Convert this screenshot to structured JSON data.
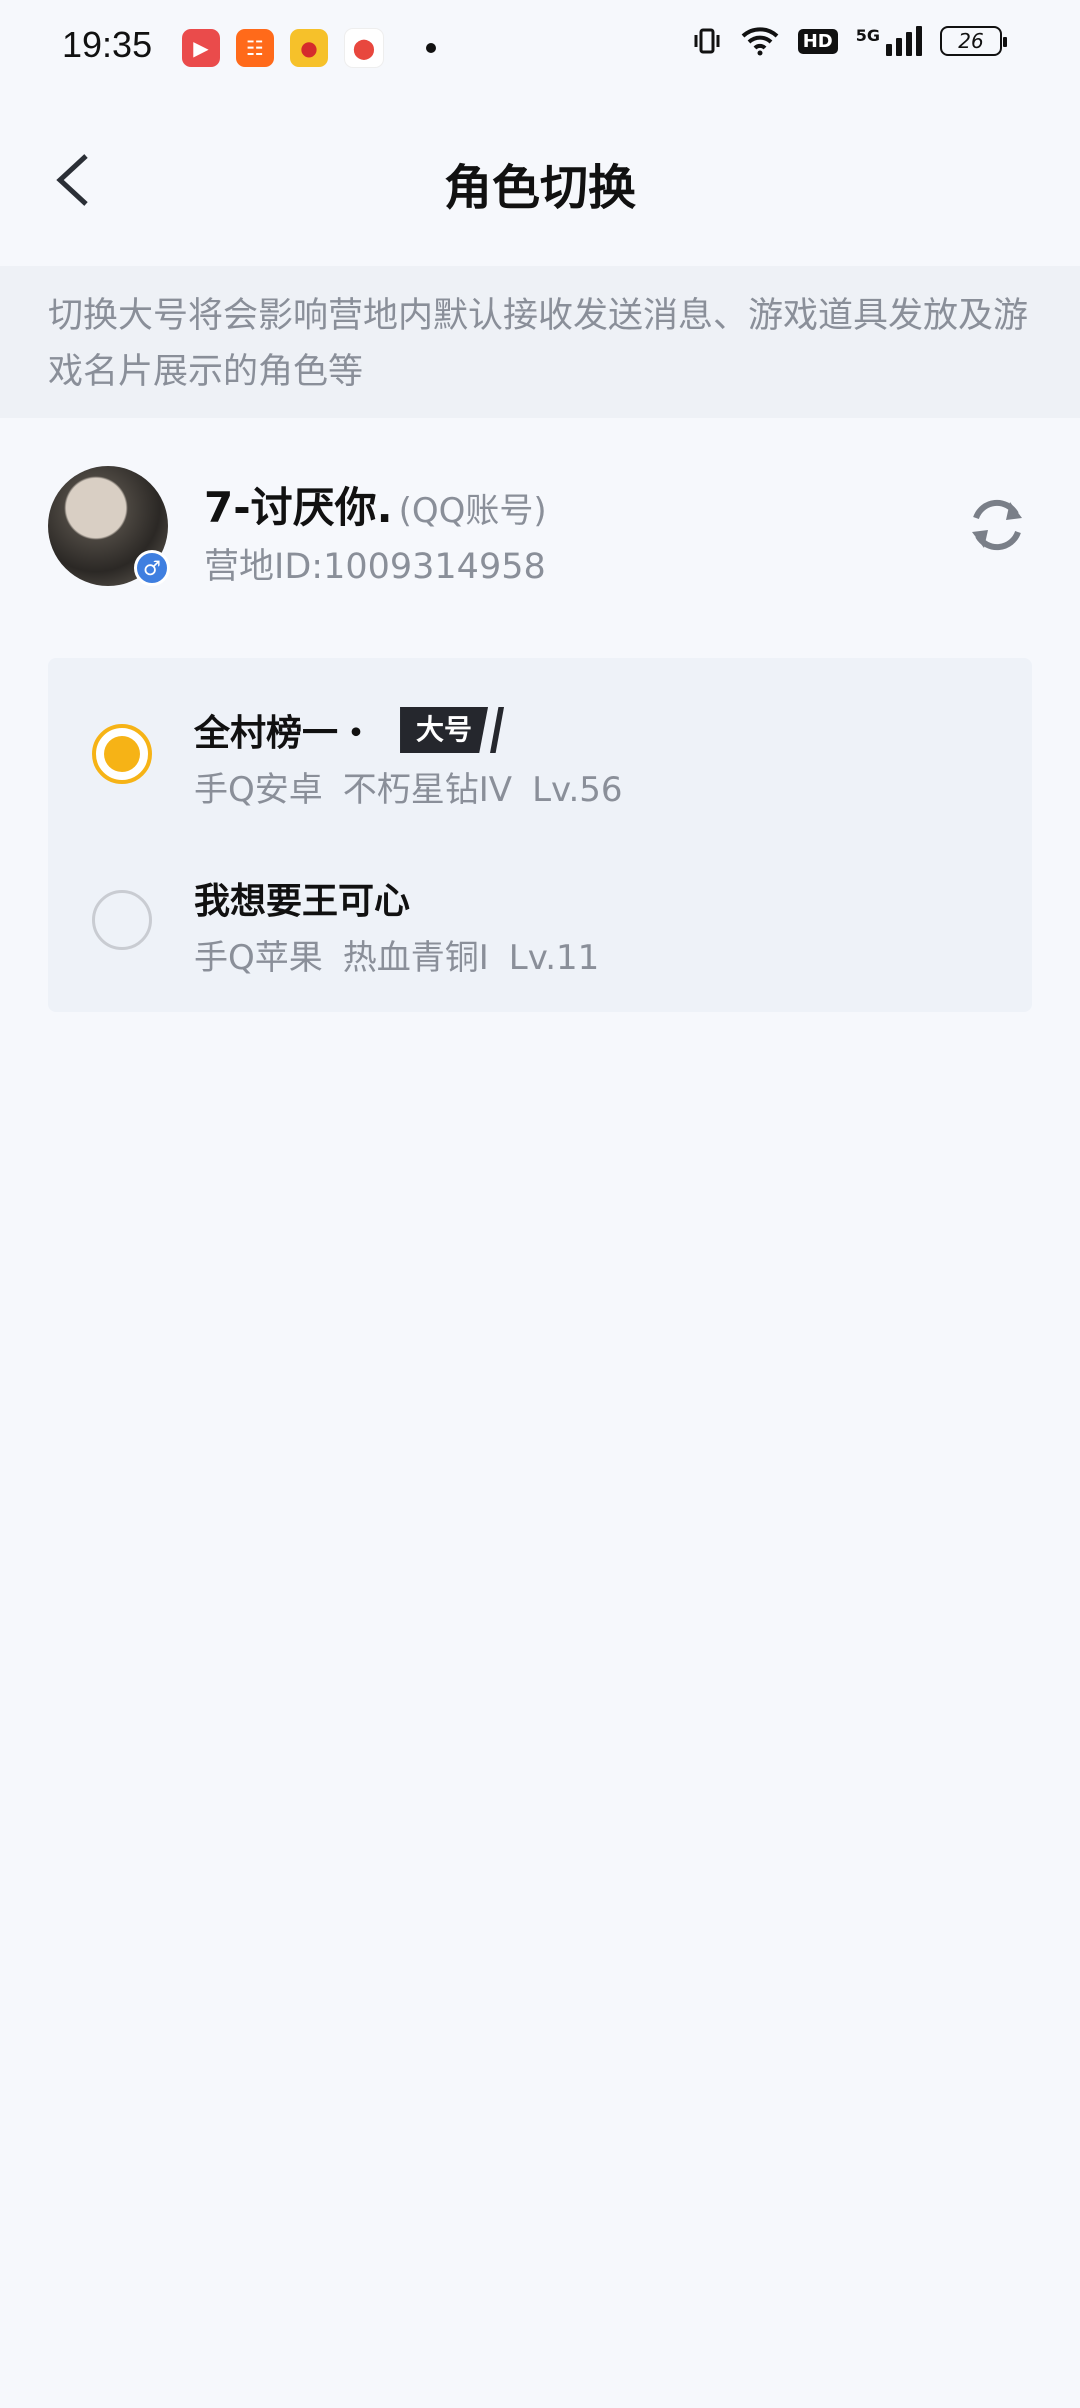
{
  "status_bar": {
    "time": "19:35",
    "hd_label": "HD",
    "network_label": "5G",
    "battery_level": "26",
    "icons": [
      "video-app-icon",
      "kuaishou-app-icon",
      "weibo-app-icon",
      "maps-app-icon",
      "vibrate-icon",
      "wifi-icon",
      "signal-icon"
    ]
  },
  "header": {
    "title": "角色切换"
  },
  "notice": {
    "text": "切换大号将会影响营地内默认接收发送消息、游戏道具发放及游戏名片展示的角色等"
  },
  "account": {
    "name": "7-讨厌你.",
    "type": "(QQ账号)",
    "id_text": "营地ID:1009314958",
    "gender_symbol": "♂"
  },
  "roles": [
    {
      "name": "全村榜一・",
      "tag": "大号",
      "platform": "手Q安卓",
      "rank": "不朽星钻IV",
      "level": "Lv.56",
      "selected": true
    },
    {
      "name": "我想要王可心",
      "platform": "手Q苹果",
      "rank": "热血青铜I",
      "level": "Lv.11",
      "selected": false
    }
  ],
  "colors": {
    "accent": "#f6b316",
    "background": "#f6f8fc",
    "secondary_text": "#8a8f99"
  }
}
